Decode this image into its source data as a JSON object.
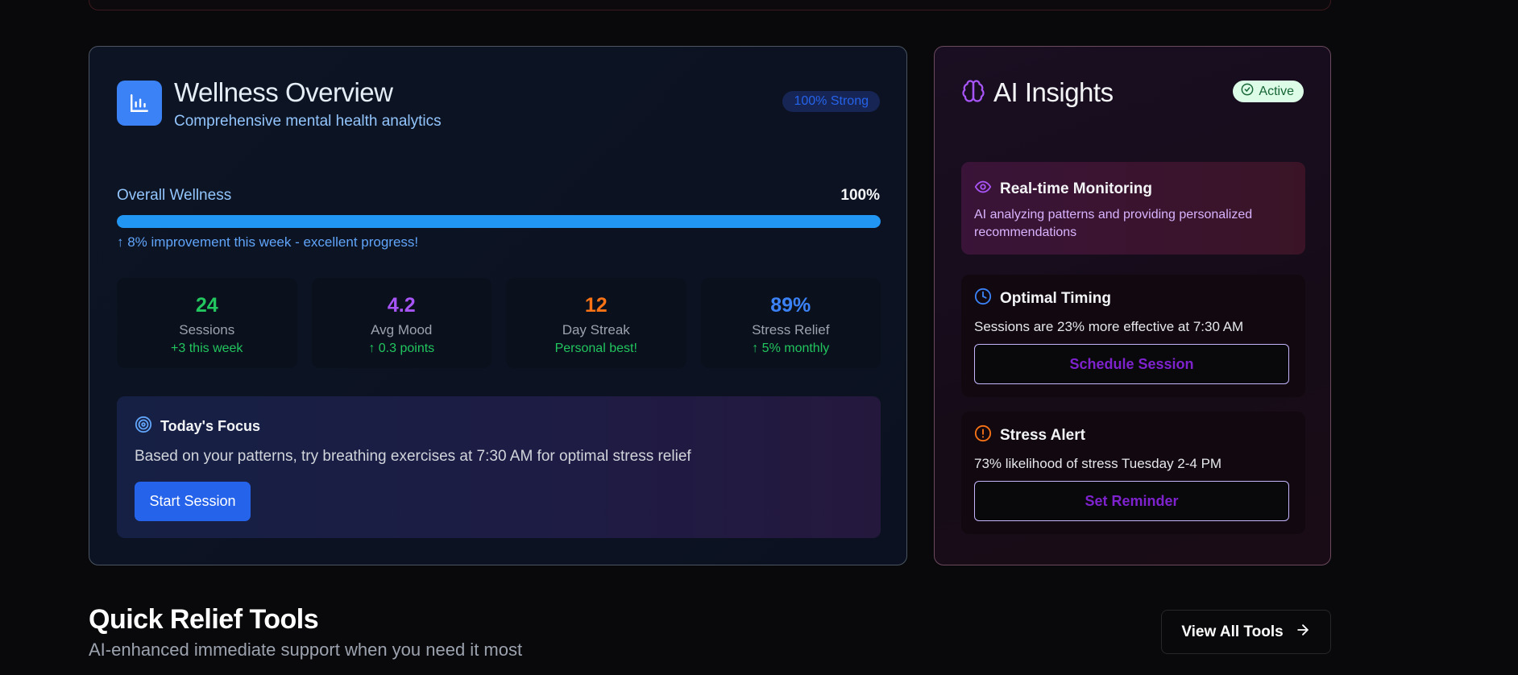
{
  "wellness": {
    "title": "Wellness Overview",
    "subtitle": "Comprehensive mental health analytics",
    "badge": "100% Strong",
    "overall_label": "Overall Wellness",
    "overall_value": "100%",
    "overall_fraction": 1.0,
    "improvement": "↑ 8% improvement this week - excellent progress!",
    "stats": [
      {
        "value": "24",
        "label": "Sessions",
        "delta": "+3 this week",
        "color": "#22c55e"
      },
      {
        "value": "4.2",
        "label": "Avg Mood",
        "delta": "↑ 0.3 points",
        "color": "#a855f7"
      },
      {
        "value": "12",
        "label": "Day Streak",
        "delta": "Personal best!",
        "color": "#f97316"
      },
      {
        "value": "89%",
        "label": "Stress Relief",
        "delta": "↑ 5% monthly",
        "color": "#3b82f6"
      }
    ],
    "focus": {
      "title": "Today's Focus",
      "text": "Based on your patterns, try breathing exercises at 7:30 AM for optimal stress relief",
      "button": "Start Session"
    }
  },
  "ai": {
    "title": "AI Insights",
    "badge": "Active",
    "realtime": {
      "title": "Real-time Monitoring",
      "text": "AI analyzing patterns and providing personalized recommendations"
    },
    "timing": {
      "title": "Optimal Timing",
      "text": "Sessions are 23% more effective at 7:30 AM",
      "button": "Schedule Session"
    },
    "stress": {
      "title": "Stress Alert",
      "text": "73% likelihood of stress Tuesday 2-4 PM",
      "button": "Set Reminder"
    }
  },
  "quick_relief": {
    "title": "Quick Relief Tools",
    "subtitle": "AI-enhanced immediate support when you need it most",
    "button": "View All Tools"
  },
  "icons": {
    "wellness": "bar-chart-icon",
    "focus": "target-icon",
    "ai": "brain-icon",
    "active": "check-circle-icon",
    "realtime": "eye-icon",
    "timing": "clock-icon",
    "stress": "alert-circle-icon",
    "view_all": "arrow-right-icon"
  }
}
